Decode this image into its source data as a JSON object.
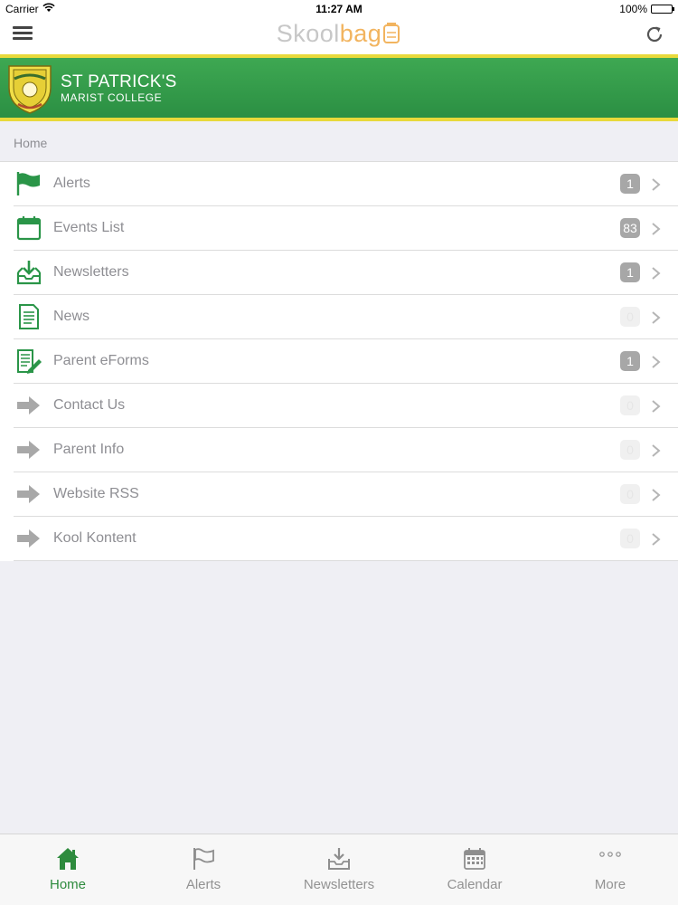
{
  "status_bar": {
    "carrier": "Carrier",
    "time": "11:27 AM",
    "battery": "100%"
  },
  "nav_bar": {
    "brand_part1": "Skool",
    "brand_part2": "bag",
    "brand_colors": {
      "part1": "#c7c7c7",
      "part2": "#f2b45f"
    }
  },
  "banner": {
    "school_name": "ST PATRICK'S",
    "school_subtitle": "MARIST COLLEGE",
    "colors": {
      "green": "#2b8f43",
      "gold": "#e8d93b"
    }
  },
  "breadcrumb": "Home",
  "menu_items": [
    {
      "label": "Alerts",
      "icon": "flag-icon",
      "badge": "1"
    },
    {
      "label": "Events List",
      "icon": "calendar-icon",
      "badge": "83"
    },
    {
      "label": "Newsletters",
      "icon": "inbox-download-icon",
      "badge": "1"
    },
    {
      "label": "News",
      "icon": "document-icon",
      "badge": "0"
    },
    {
      "label": "Parent eForms",
      "icon": "form-pencil-icon",
      "badge": "1"
    },
    {
      "label": "Contact Us",
      "icon": "arrow-right-icon",
      "badge": "0"
    },
    {
      "label": "Parent Info",
      "icon": "arrow-right-icon",
      "badge": "0"
    },
    {
      "label": "Website RSS",
      "icon": "arrow-right-icon",
      "badge": "0"
    },
    {
      "label": "Kool Kontent",
      "icon": "arrow-right-icon",
      "badge": "0"
    }
  ],
  "tab_bar": {
    "active_color": "#2e8b3e",
    "tabs": [
      {
        "label": "Home",
        "icon": "home-icon",
        "active": true
      },
      {
        "label": "Alerts",
        "icon": "flag-icon",
        "active": false
      },
      {
        "label": "Newsletters",
        "icon": "inbox-download-icon",
        "active": false
      },
      {
        "label": "Calendar",
        "icon": "calendar-grid-icon",
        "active": false
      },
      {
        "label": "More",
        "icon": "more-dots-icon",
        "active": false
      }
    ]
  }
}
